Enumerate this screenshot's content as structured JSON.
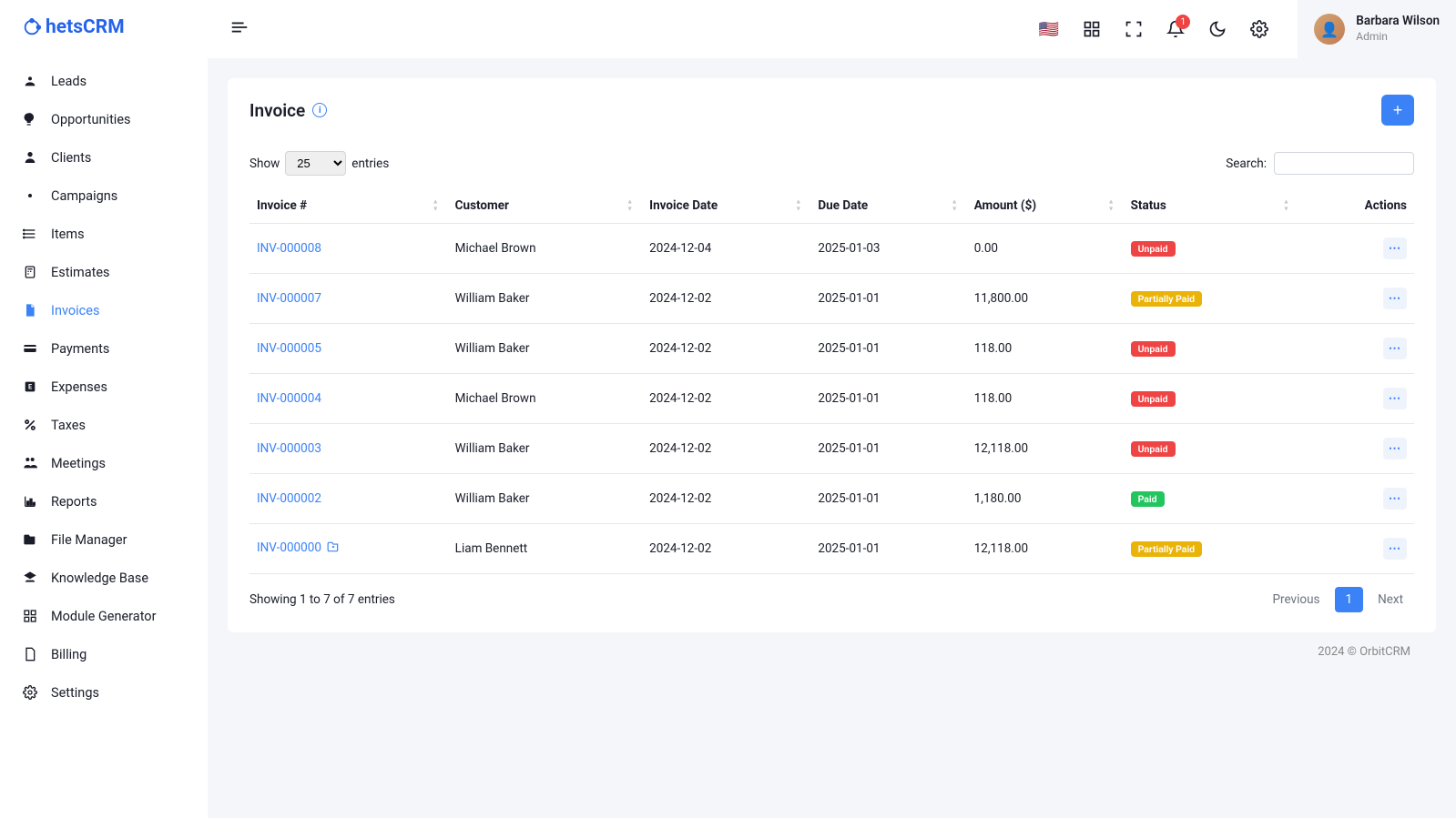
{
  "brand": "hetsCRM",
  "sidebar": {
    "items": [
      {
        "icon": "leads",
        "label": "Leads"
      },
      {
        "icon": "opportunities",
        "label": "Opportunities"
      },
      {
        "icon": "clients",
        "label": "Clients"
      },
      {
        "icon": "campaigns",
        "label": "Campaigns"
      },
      {
        "icon": "items",
        "label": "Items"
      },
      {
        "icon": "estimates",
        "label": "Estimates"
      },
      {
        "icon": "invoices",
        "label": "Invoices",
        "active": true
      },
      {
        "icon": "payments",
        "label": "Payments"
      },
      {
        "icon": "expenses",
        "label": "Expenses"
      },
      {
        "icon": "taxes",
        "label": "Taxes"
      },
      {
        "icon": "meetings",
        "label": "Meetings"
      },
      {
        "icon": "reports",
        "label": "Reports"
      },
      {
        "icon": "filemanager",
        "label": "File Manager"
      },
      {
        "icon": "knowledgebase",
        "label": "Knowledge Base"
      },
      {
        "icon": "modulegenerator",
        "label": "Module Generator"
      },
      {
        "icon": "billing",
        "label": "Billing"
      },
      {
        "icon": "settings",
        "label": "Settings"
      }
    ]
  },
  "topbar": {
    "notificationCount": "1",
    "user": {
      "name": "Barbara Wilson",
      "role": "Admin"
    }
  },
  "page": {
    "title": "Invoice",
    "show_label": "Show",
    "entries_label": "entries",
    "page_size": "25",
    "search_label": "Search:",
    "columns": [
      "Invoice #",
      "Customer",
      "Invoice Date",
      "Due Date",
      "Amount ($)",
      "Status",
      "Actions"
    ],
    "rows": [
      {
        "num": "INV-000008",
        "customer": "Michael Brown",
        "date": "2024-12-04",
        "due": "2025-01-03",
        "amount": "0.00",
        "status": "Unpaid",
        "status_class": "unpaid"
      },
      {
        "num": "INV-000007",
        "customer": "William Baker",
        "date": "2024-12-02",
        "due": "2025-01-01",
        "amount": "11,800.00",
        "status": "Partially Paid",
        "status_class": "partial"
      },
      {
        "num": "INV-000005",
        "customer": "William Baker",
        "date": "2024-12-02",
        "due": "2025-01-01",
        "amount": "118.00",
        "status": "Unpaid",
        "status_class": "unpaid"
      },
      {
        "num": "INV-000004",
        "customer": "Michael Brown",
        "date": "2024-12-02",
        "due": "2025-01-01",
        "amount": "118.00",
        "status": "Unpaid",
        "status_class": "unpaid"
      },
      {
        "num": "INV-000003",
        "customer": "William Baker",
        "date": "2024-12-02",
        "due": "2025-01-01",
        "amount": "12,118.00",
        "status": "Unpaid",
        "status_class": "unpaid"
      },
      {
        "num": "INV-000002",
        "customer": "William Baker",
        "date": "2024-12-02",
        "due": "2025-01-01",
        "amount": "1,180.00",
        "status": "Paid",
        "status_class": "paid"
      },
      {
        "num": "INV-000000",
        "customer": "Liam Bennett",
        "date": "2024-12-02",
        "due": "2025-01-01",
        "amount": "12,118.00",
        "status": "Partially Paid",
        "status_class": "partial",
        "recurring": true
      }
    ],
    "summary": "Showing 1 to 7 of 7 entries",
    "pagination": {
      "prev": "Previous",
      "next": "Next",
      "current": "1"
    }
  },
  "footer": "2024 © OrbitCRM"
}
